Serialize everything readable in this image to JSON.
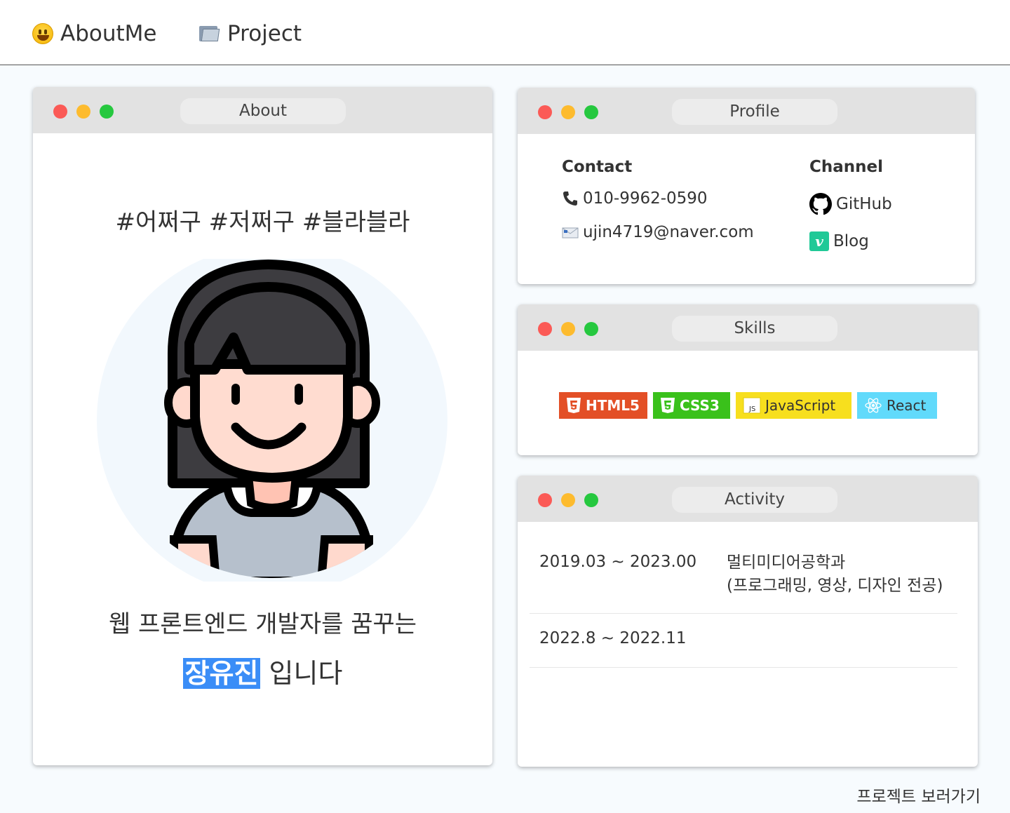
{
  "nav": {
    "about_label": "AboutMe",
    "project_label": "Project"
  },
  "windows": {
    "about": {
      "title": "About",
      "hashtags": "#어쩌구 #저쩌구 #블라블라",
      "intro": "웹 프론트엔드 개발자를 꿈꾸는",
      "name": "장유진",
      "name_suffix": "입니다"
    },
    "profile": {
      "title": "Profile",
      "contact_head": "Contact",
      "phone": "010-9962-0590",
      "email": "ujin4719@naver.com",
      "channel_head": "Channel",
      "github_label": "GitHub",
      "blog_label": "Blog"
    },
    "skills": {
      "title": "Skills",
      "badges": [
        "HTML5",
        "CSS3",
        "JavaScript",
        "React"
      ]
    },
    "activity": {
      "title": "Activity",
      "rows": [
        {
          "date": "2019.03 ~ 2023.00",
          "desc1": "멀티미디어공학과",
          "desc2": "(프로그래밍, 영상, 디자인 전공)"
        },
        {
          "date": "2022.8 ~ 2022.11"
        }
      ]
    }
  },
  "footer": {
    "link_label": "프로젝트 보러가기"
  },
  "colors": {
    "dot_red": "#fb5a56",
    "dot_yellow": "#fdbb2e",
    "dot_green": "#26c83f",
    "name_highlight": "#3a8df7",
    "html5": "#e34f26",
    "css3": "#3ac11b",
    "javascript": "#f7df1e",
    "react": "#61dafb",
    "velog": "#20c997"
  },
  "icons": {
    "about_nav": "grinning-face-icon",
    "project_nav": "folder-icon",
    "phone": "phone-icon",
    "email": "envelope-icon",
    "github": "github-icon",
    "blog": "velog-icon"
  }
}
